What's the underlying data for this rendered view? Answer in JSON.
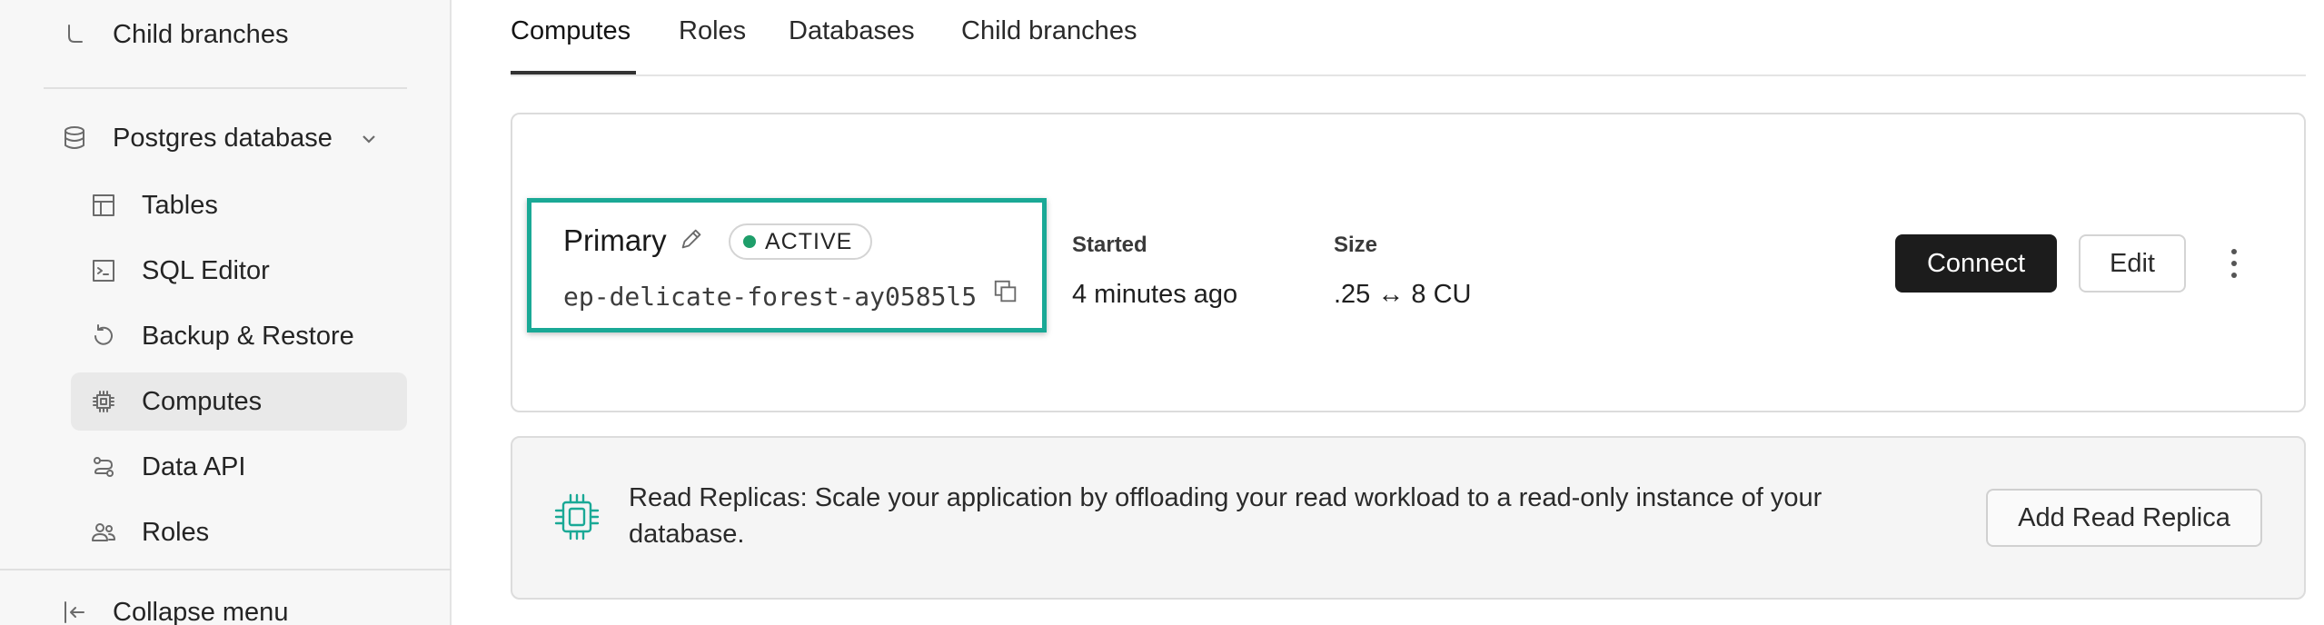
{
  "sidebar": {
    "child_branches": "Child branches",
    "postgres_database": "Postgres database",
    "items": [
      {
        "label": "Tables"
      },
      {
        "label": "SQL Editor"
      },
      {
        "label": "Backup & Restore"
      },
      {
        "label": "Computes"
      },
      {
        "label": "Data API"
      },
      {
        "label": "Roles"
      }
    ],
    "active_item": "Computes",
    "collapse_menu": "Collapse menu"
  },
  "tabs": [
    {
      "label": "Computes",
      "active": true
    },
    {
      "label": "Roles",
      "active": false
    },
    {
      "label": "Databases",
      "active": false
    },
    {
      "label": "Child branches",
      "active": false
    }
  ],
  "compute": {
    "name": "Primary",
    "status": "ACTIVE",
    "endpoint": "ep-delicate-forest-ay0585l5",
    "started_label": "Started",
    "started_value": "4 minutes ago",
    "size_label": "Size",
    "size_value": ".25 ↔ 8 CU",
    "connect_label": "Connect",
    "edit_label": "Edit"
  },
  "replica": {
    "text": "Read Replicas: Scale your application by offloading your read workload to a read-only instance of your database.",
    "button_label": "Add Read Replica"
  },
  "colors": {
    "accent": "#1aa996",
    "status_active": "#1e9e6a",
    "primary_button": "#1c1c1c"
  }
}
